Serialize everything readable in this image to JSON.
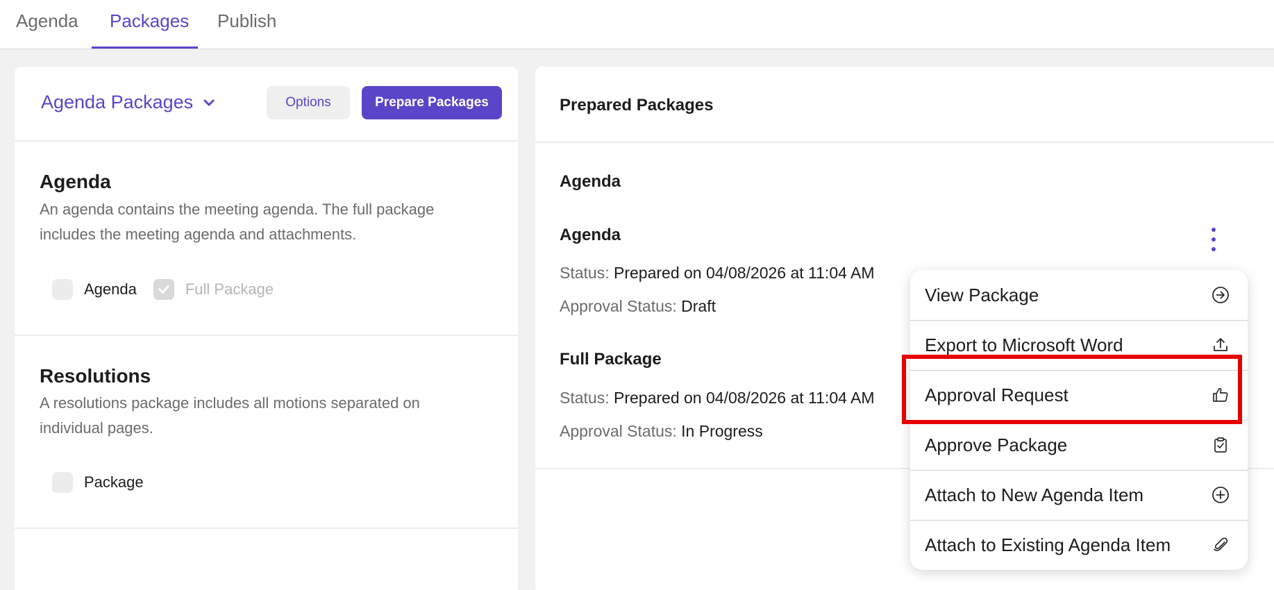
{
  "tabs": [
    {
      "label": "Agenda"
    },
    {
      "label": "Packages"
    },
    {
      "label": "Publish"
    }
  ],
  "left_panel": {
    "dropdown_label": "Agenda Packages",
    "options_label": "Options",
    "prepare_label": "Prepare Packages",
    "sections": [
      {
        "title": "Agenda",
        "description": "An agenda contains the meeting agenda. The full package includes the meeting agenda and attachments.",
        "checkboxes": [
          {
            "label": "Agenda",
            "checked": false
          },
          {
            "label": "Full Package",
            "checked": true
          }
        ]
      },
      {
        "title": "Resolutions",
        "description": "A resolutions package includes all motions separated on individual pages.",
        "checkboxes": [
          {
            "label": "Package",
            "checked": false
          }
        ]
      }
    ]
  },
  "right_panel": {
    "title": "Prepared Packages",
    "group": "Agenda",
    "packages": [
      {
        "name": "Agenda",
        "status_label": "Status:",
        "status_value": "Prepared on 04/08/2026 at 11:04 AM",
        "approval_label": "Approval Status:",
        "approval_value": "Draft"
      },
      {
        "name": "Full Package",
        "status_label": "Status:",
        "status_value": "Prepared on 04/08/2026 at 11:04 AM",
        "approval_label": "Approval Status:",
        "approval_value": "In Progress"
      }
    ]
  },
  "context_menu": {
    "items": [
      {
        "label": "View Package",
        "icon": "arrow-circle-right-icon"
      },
      {
        "label": "Export to Microsoft Word",
        "icon": "upload-icon"
      },
      {
        "label": "Approval Request",
        "icon": "thumbs-up-icon"
      },
      {
        "label": "Approve Package",
        "icon": "clipboard-check-icon"
      },
      {
        "label": "Attach to New Agenda Item",
        "icon": "plus-circle-icon"
      },
      {
        "label": "Attach to Existing Agenda Item",
        "icon": "paperclip-icon"
      }
    ],
    "highlighted_item": "Approval Request"
  },
  "colors": {
    "accent": "#5a45c8",
    "highlight": "#e80000"
  }
}
